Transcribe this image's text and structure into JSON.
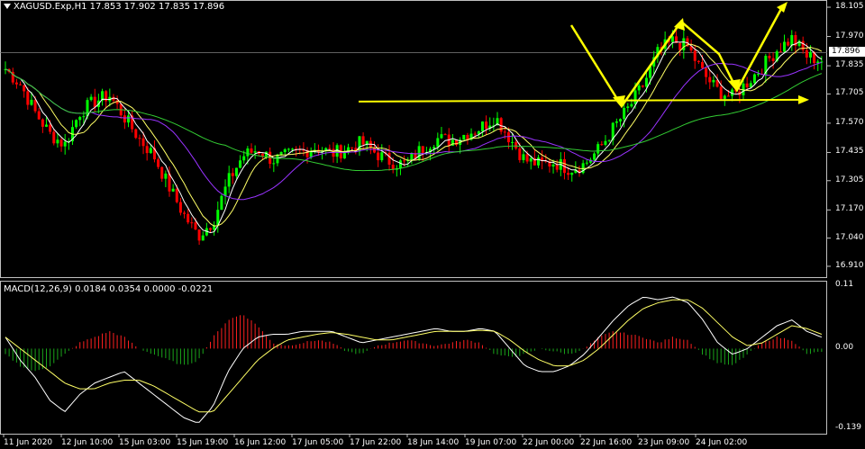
{
  "header": {
    "symbol_line": "XAGUSD.Exp,H1  17.853 17.902 17.835 17.896",
    "macd_line": "MACD(12,26,9) 0.0184 0.0354 0.0000 -0.0221"
  },
  "current_price": "17.896",
  "colors": {
    "background": "#000000",
    "bull_candle": "#00ff00",
    "bear_candle": "#ff0000",
    "annotation": "#ffff00",
    "hist_pos": "#ff2020",
    "hist_neg": "#1aa51a",
    "ma_fast": "#ffffff",
    "ma_mid": "#ffff66",
    "ma_slow": "#9933ff",
    "ma_long": "#33cc33"
  },
  "chart_data": [
    {
      "type": "candlestick",
      "title": "XAGUSD.Exp,H1",
      "ylim": [
        16.86,
        18.13
      ],
      "y_ticks": [
        "18.105",
        "17.970",
        "17.835",
        "17.705",
        "17.570",
        "17.435",
        "17.305",
        "17.170",
        "17.040",
        "16.910"
      ],
      "x_ticks": [
        "11 Jun 2020",
        "12 Jun 10:00",
        "15 Jun 03:00",
        "15 Jun 19:00",
        "16 Jun 12:00",
        "17 Jun 05:00",
        "17 Jun 22:00",
        "18 Jun 14:00",
        "19 Jun 07:00",
        "22 Jun 00:00",
        "22 Jun 16:00",
        "23 Jun 09:00",
        "24 Jun 02:00"
      ],
      "path_close": [
        17.82,
        17.75,
        17.62,
        17.52,
        17.47,
        17.62,
        17.67,
        17.7,
        17.6,
        17.5,
        17.42,
        17.28,
        17.15,
        17.05,
        17.12,
        17.3,
        17.42,
        17.45,
        17.4,
        17.42,
        17.44,
        17.46,
        17.43,
        17.45,
        17.48,
        17.43,
        17.39,
        17.38,
        17.45,
        17.5,
        17.49,
        17.52,
        17.55,
        17.6,
        17.5,
        17.4,
        17.38,
        17.39,
        17.36,
        17.38,
        17.45,
        17.55,
        17.64,
        17.75,
        17.9,
        17.95,
        17.92,
        17.8,
        17.72,
        17.69,
        17.76,
        17.83,
        17.91,
        17.96,
        17.88,
        17.86
      ],
      "horizontal_level": 17.67,
      "series": [
        {
          "name": "",
          "values": [
            17.82,
            17.75,
            17.62,
            17.52,
            17.47,
            17.62,
            17.67,
            17.7,
            17.6,
            17.5,
            17.42,
            17.28,
            17.15,
            17.05,
            17.12,
            17.3,
            17.42,
            17.45,
            17.4,
            17.42,
            17.44,
            17.46,
            17.43,
            17.45,
            17.48,
            17.43,
            17.39,
            17.38,
            17.45,
            17.5,
            17.49,
            17.52,
            17.55,
            17.6,
            17.5,
            17.4,
            17.38,
            17.39,
            17.36,
            17.38,
            17.45,
            17.55,
            17.64,
            17.75,
            17.9,
            17.95,
            17.92,
            17.8,
            17.72,
            17.69,
            17.76,
            17.83,
            17.91,
            17.96,
            17.88,
            17.86
          ]
        }
      ]
    },
    {
      "type": "bar",
      "title": "MACD(12,26,9)",
      "ylim": [
        -0.145,
        0.115
      ],
      "y_ticks": [
        "0.11",
        "0.00",
        "-0.139"
      ],
      "histogram": [
        -0.01,
        -0.03,
        -0.04,
        -0.03,
        -0.01,
        0.01,
        0.02,
        0.03,
        0.02,
        0.0,
        -0.01,
        -0.02,
        -0.03,
        -0.02,
        0.02,
        0.05,
        0.06,
        0.04,
        0.01,
        0.005,
        0.01,
        0.015,
        0.01,
        -0.005,
        -0.01,
        0.005,
        0.01,
        0.015,
        0.01,
        0.005,
        0.01,
        0.015,
        0.01,
        -0.01,
        -0.015,
        -0.01,
        0.0,
        -0.005,
        -0.01,
        0.0,
        0.02,
        0.03,
        0.025,
        0.02,
        0.01,
        0.02,
        0.015,
        -0.01,
        -0.025,
        -0.03,
        -0.01,
        0.01,
        0.02,
        0.015,
        -0.01,
        -0.005
      ],
      "macd_line": [
        0.02,
        -0.02,
        -0.05,
        -0.09,
        -0.11,
        -0.08,
        -0.06,
        -0.05,
        -0.04,
        -0.06,
        -0.08,
        -0.1,
        -0.12,
        -0.13,
        -0.1,
        -0.04,
        0.0,
        0.02,
        0.025,
        0.025,
        0.03,
        0.03,
        0.03,
        0.02,
        0.01,
        0.015,
        0.02,
        0.025,
        0.03,
        0.035,
        0.03,
        0.03,
        0.035,
        0.03,
        0.0,
        -0.03,
        -0.04,
        -0.04,
        -0.03,
        -0.01,
        0.02,
        0.05,
        0.075,
        0.09,
        0.085,
        0.09,
        0.08,
        0.05,
        0.01,
        -0.01,
        0.0,
        0.02,
        0.04,
        0.05,
        0.03,
        0.02
      ],
      "signal_line": [
        0.02,
        0.0,
        -0.02,
        -0.04,
        -0.06,
        -0.07,
        -0.07,
        -0.06,
        -0.055,
        -0.055,
        -0.065,
        -0.08,
        -0.095,
        -0.11,
        -0.11,
        -0.08,
        -0.05,
        -0.02,
        0.0,
        0.015,
        0.02,
        0.025,
        0.028,
        0.025,
        0.02,
        0.015,
        0.015,
        0.02,
        0.025,
        0.03,
        0.03,
        0.03,
        0.032,
        0.03,
        0.015,
        -0.005,
        -0.02,
        -0.03,
        -0.03,
        -0.02,
        0.0,
        0.025,
        0.05,
        0.07,
        0.08,
        0.085,
        0.085,
        0.07,
        0.045,
        0.02,
        0.005,
        0.01,
        0.025,
        0.04,
        0.035,
        0.025
      ]
    }
  ]
}
